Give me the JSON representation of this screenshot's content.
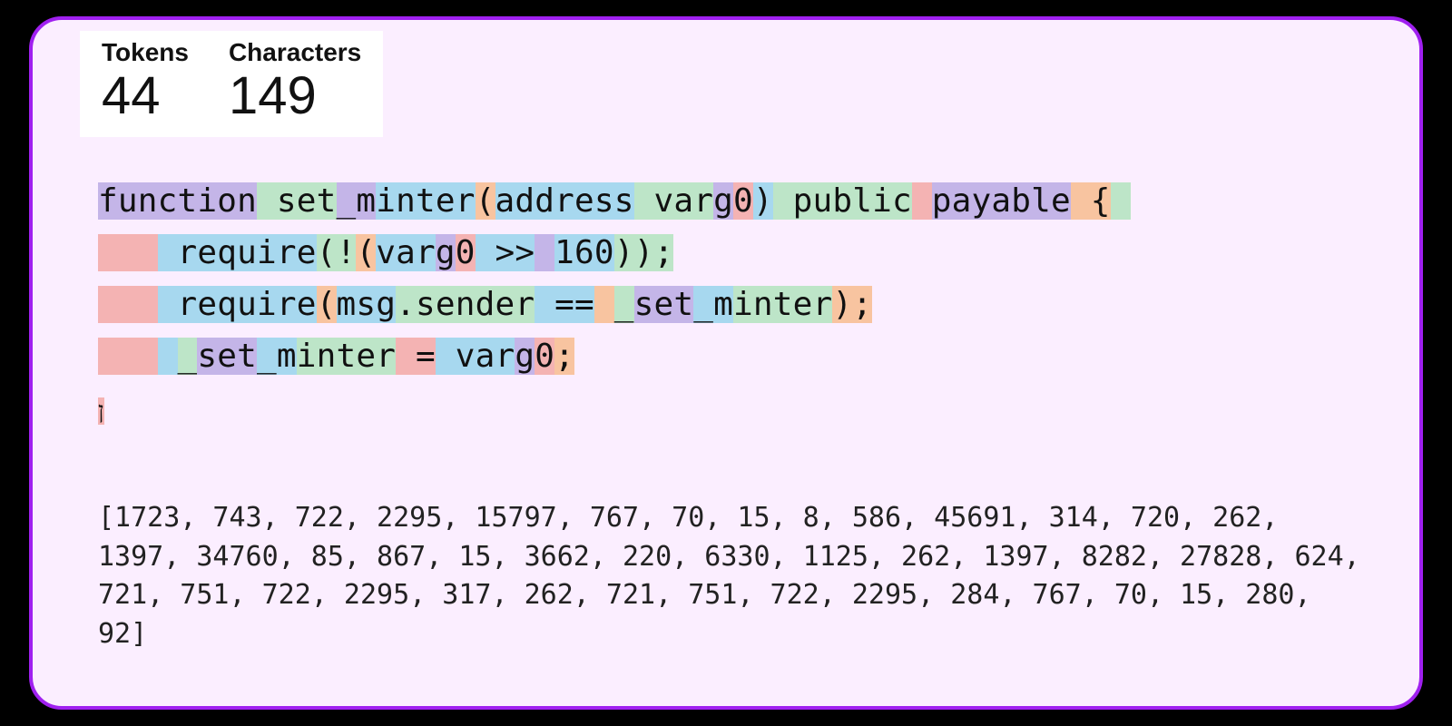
{
  "stats": {
    "tokens_label": "Tokens",
    "tokens_value": "44",
    "chars_label": "Characters",
    "chars_value": "149"
  },
  "palette": [
    "c0",
    "c1",
    "c2",
    "c3",
    "c4"
  ],
  "code_lines": [
    [
      {
        "t": "function",
        "c": 0
      },
      {
        "t": " set",
        "c": 1
      },
      {
        "t": "_m",
        "c": 0
      },
      {
        "t": "inter",
        "c": 3
      },
      {
        "t": "(",
        "c": 2
      },
      {
        "t": "address",
        "c": 3
      },
      {
        "t": " var",
        "c": 1
      },
      {
        "t": "g",
        "c": 0
      },
      {
        "t": "0",
        "c": 4
      },
      {
        "t": ")",
        "c": 3
      },
      {
        "t": " public",
        "c": 1
      },
      {
        "t": " ",
        "c": 4
      },
      {
        "t": "payable",
        "c": 0
      },
      {
        "t": " {",
        "c": 2
      },
      {
        "t": " ",
        "c": 1
      }
    ],
    [
      {
        "t": "   ",
        "c": 4
      },
      {
        "t": " require",
        "c": 3
      },
      {
        "t": "(!",
        "c": 1
      },
      {
        "t": "(",
        "c": 2
      },
      {
        "t": "var",
        "c": 3
      },
      {
        "t": "g",
        "c": 0
      },
      {
        "t": "0",
        "c": 4
      },
      {
        "t": " >>",
        "c": 3
      },
      {
        "t": " ",
        "c": 0
      },
      {
        "t": "160",
        "c": 3
      },
      {
        "t": "));",
        "c": 1
      }
    ],
    [
      {
        "t": "   ",
        "c": 4
      },
      {
        "t": " require",
        "c": 3
      },
      {
        "t": "(",
        "c": 2
      },
      {
        "t": "msg",
        "c": 3
      },
      {
        "t": ".sender",
        "c": 1
      },
      {
        "t": " ==",
        "c": 3
      },
      {
        "t": " ",
        "c": 2
      },
      {
        "t": "_",
        "c": 1
      },
      {
        "t": "set",
        "c": 0
      },
      {
        "t": "_m",
        "c": 3
      },
      {
        "t": "inter",
        "c": 1
      },
      {
        "t": ");",
        "c": 2
      }
    ],
    [
      {
        "t": "   ",
        "c": 4
      },
      {
        "t": " ",
        "c": 3
      },
      {
        "t": "_",
        "c": 1
      },
      {
        "t": "set",
        "c": 0
      },
      {
        "t": "_m",
        "c": 3
      },
      {
        "t": "inter",
        "c": 1
      },
      {
        "t": " =",
        "c": 4
      },
      {
        "t": " var",
        "c": 3
      },
      {
        "t": "g",
        "c": 0
      },
      {
        "t": "0",
        "c": 4
      },
      {
        "t": ";",
        "c": 2
      }
    ]
  ],
  "dangling_glyph": "ן",
  "token_ids": [
    1723,
    743,
    722,
    2295,
    15797,
    767,
    70,
    15,
    8,
    586,
    45691,
    314,
    720,
    262,
    1397,
    34760,
    85,
    867,
    15,
    3662,
    220,
    6330,
    1125,
    262,
    1397,
    8282,
    27828,
    624,
    721,
    751,
    722,
    2295,
    317,
    262,
    721,
    751,
    722,
    2295,
    284,
    767,
    70,
    15,
    280,
    92
  ],
  "ids_prefix": "[",
  "ids_suffix": "]"
}
